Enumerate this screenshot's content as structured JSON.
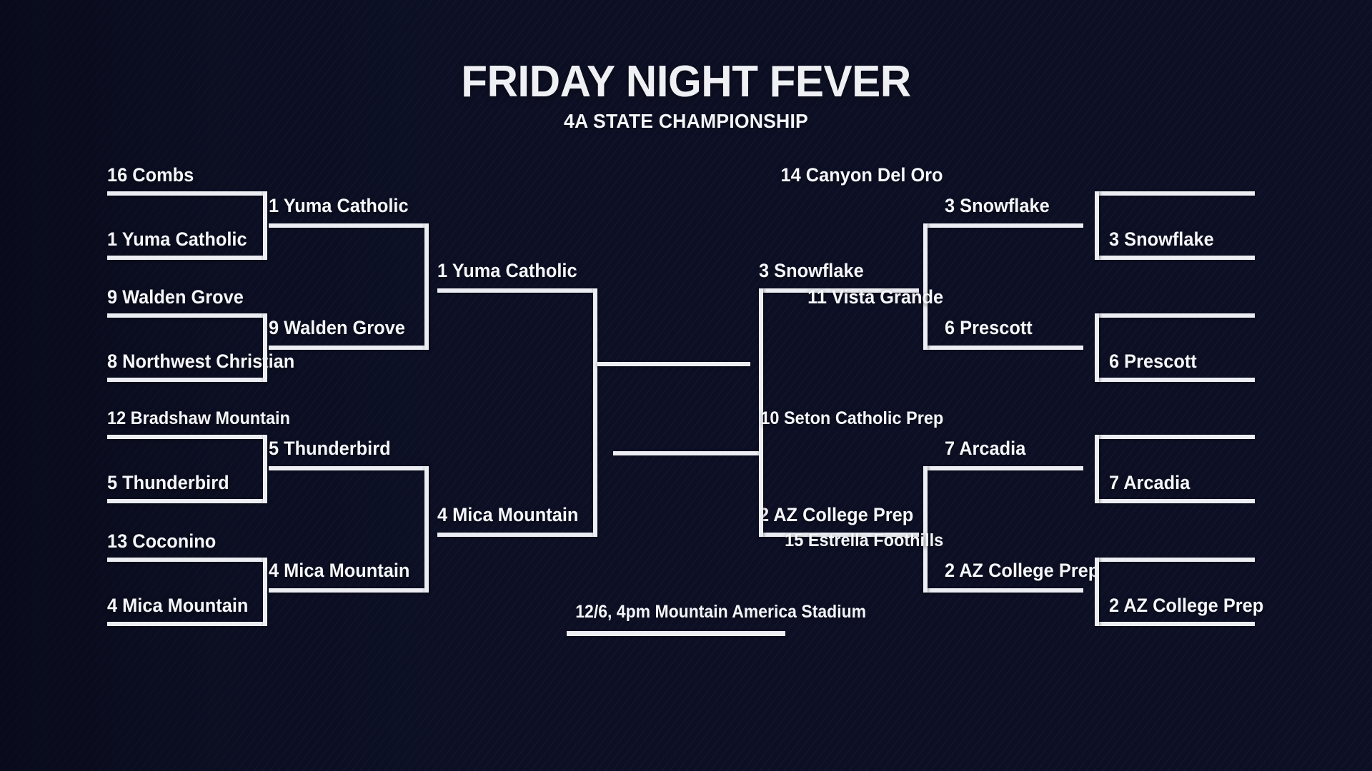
{
  "header": {
    "title": "FRIDAY NIGHT FEVER",
    "subtitle": "4A STATE CHAMPIONSHIP"
  },
  "footer": {
    "final_info": "12/6, 4pm Mountain America Stadium"
  },
  "colors": {
    "background": "#1a1f3d",
    "bracket_line": "#eceef3",
    "text": "#f4f6fa"
  },
  "bracket": {
    "left": {
      "round1": [
        {
          "top": "16 Combs",
          "bottom": "1 Yuma Catholic"
        },
        {
          "top": "9 Walden Grove",
          "bottom": "8 Northwest Christian"
        },
        {
          "top": "12 Bradshaw Mountain",
          "bottom": "5 Thunderbird"
        },
        {
          "top": "13 Coconino",
          "bottom": "4 Mica Mountain"
        }
      ],
      "round2": [
        {
          "top": "1 Yuma Catholic",
          "bottom": "9 Walden Grove"
        },
        {
          "top": "5 Thunderbird",
          "bottom": "4 Mica Mountain"
        }
      ],
      "round3": [
        {
          "top": "1 Yuma Catholic",
          "bottom": "4 Mica Mountain"
        }
      ],
      "final_slot": ""
    },
    "right": {
      "round1": [
        {
          "top": "14 Canyon Del Oro",
          "bottom": "3 Snowflake"
        },
        {
          "top": "11 Vista Grande",
          "bottom": "6 Prescott"
        },
        {
          "top": "10 Seton Catholic Prep",
          "bottom": "7 Arcadia"
        },
        {
          "top": "15 Estrella Foothills",
          "bottom": "2 AZ College Prep"
        }
      ],
      "round2": [
        {
          "top": "3 Snowflake",
          "bottom": "6 Prescott"
        },
        {
          "top": "7 Arcadia",
          "bottom": "2 AZ College Prep"
        }
      ],
      "round3": [
        {
          "top": "3 Snowflake",
          "bottom": "2 AZ College Prep"
        }
      ],
      "final_slot": ""
    }
  }
}
